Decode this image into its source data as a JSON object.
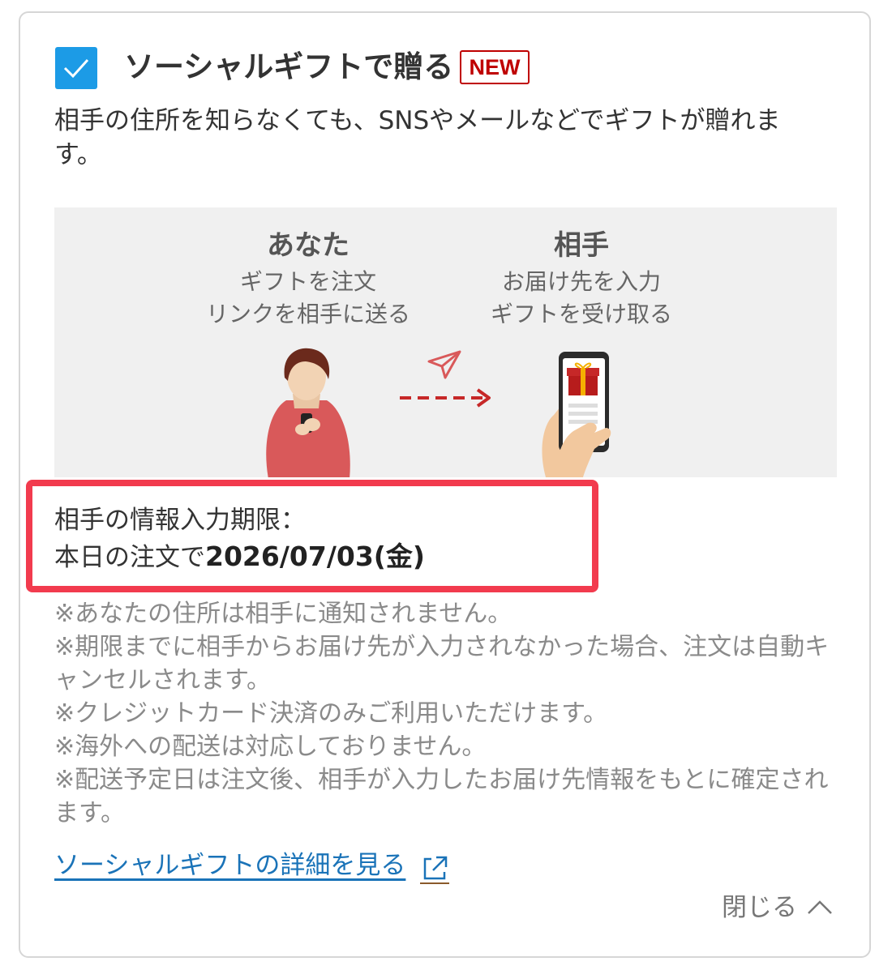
{
  "option": {
    "checked": true,
    "title": "ソーシャルギフトで贈る",
    "badge": "NEW",
    "description": "相手の住所を知らなくても、SNSやメールなどでギフトが贈れます。",
    "accent_color": "#1c9be6",
    "badge_color": "#bf0000"
  },
  "illustration": {
    "you": {
      "heading": "あなた",
      "line1": "ギフトを注文",
      "line2": "リンクを相手に送る"
    },
    "partner": {
      "heading": "相手",
      "line1": "お届け先を入力",
      "line2": "ギフトを受け取る"
    },
    "icons": [
      "person-with-phone-icon",
      "paper-plane-icon",
      "dashed-arrow-icon",
      "phone-with-gift-icon"
    ]
  },
  "deadline": {
    "label": "相手の情報入力期限：",
    "prefix": "本日の注文で",
    "date": "2026/07/03(金)",
    "highlight_color": "#f23b4e"
  },
  "notes": [
    "※あなたの住所は相手に通知されません。",
    "※期限までに相手からお届け先が入力されなかった場合、注文は自動キャンセルされます。",
    "※クレジットカード決済のみご利用いただけます。",
    "※海外への配送は対応しておりません。",
    "※配送予定日は注文後、相手が入力したお届け先情報をもとに確定されます。"
  ],
  "link": {
    "label": "ソーシャルギフトの詳細を見る",
    "icon": "external-link-icon",
    "color": "#1a73b8"
  },
  "close": {
    "label": "閉じる",
    "icon": "chevron-up-icon"
  }
}
